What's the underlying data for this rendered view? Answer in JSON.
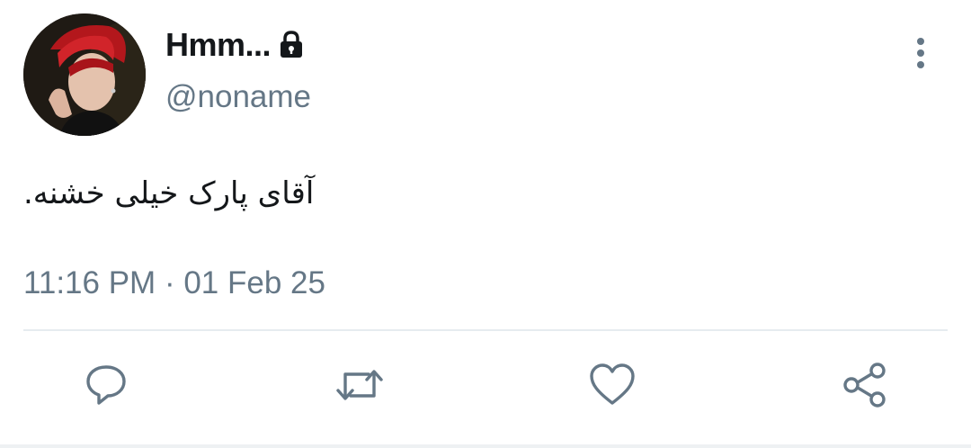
{
  "tweet": {
    "display_name": "Hmm...",
    "handle": "@noname",
    "text": "آقای پارک خیلی خشنه.",
    "time": "11:16 PM",
    "separator": "·",
    "date": "01 Feb 25"
  },
  "icons": {
    "lock": "lock-icon",
    "more": "more-vertical-icon",
    "reply": "reply-icon",
    "retweet": "retweet-icon",
    "like": "like-icon",
    "share": "share-icon"
  },
  "colors": {
    "text_primary": "#14171a",
    "text_secondary": "#657786",
    "divider": "#e6ecf0"
  }
}
